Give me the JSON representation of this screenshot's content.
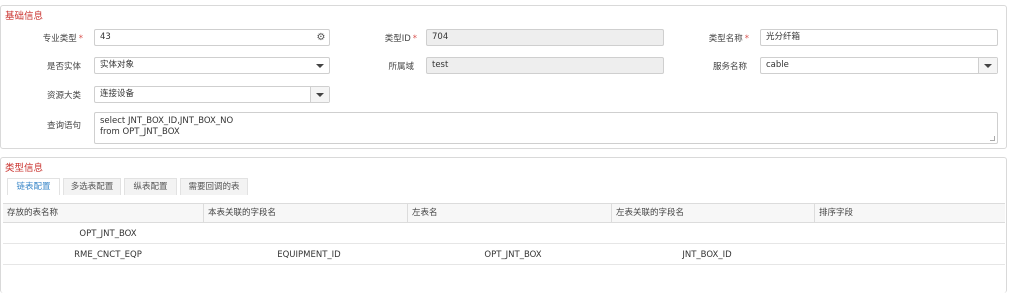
{
  "basic": {
    "title": "基础信息",
    "specialty_label": "专业类型",
    "specialty_value": "43",
    "type_id_label": "类型ID",
    "type_id_value": "704",
    "type_name_label": "类型名称",
    "type_name_value": "光分纤箱",
    "is_entity_label": "是否实体",
    "is_entity_value": "实体对象",
    "domain_label": "所属域",
    "domain_value": "test",
    "service_label": "服务名称",
    "service_value": "cable",
    "resource_label": "资源大类",
    "resource_value": "连接设备",
    "query_label": "查询语句",
    "query_line1": "select JNT_BOX_ID,JNT_BOX_NO",
    "query_line2": "from OPT_JNT_BOX"
  },
  "typeinfo": {
    "title": "类型信息",
    "tabs": [
      "链表配置",
      "多选表配置",
      "纵表配置",
      "需要回调的表"
    ],
    "active_tab": 0,
    "columns": [
      "存放的表名称",
      "本表关联的字段名",
      "左表名",
      "左表关联的字段名",
      "排序字段"
    ],
    "rows": [
      [
        "OPT_JNT_BOX",
        "",
        "",
        "",
        ""
      ],
      [
        "RME_CNCT_EQP",
        "EQUIPMENT_ID",
        "OPT_JNT_BOX",
        "JNT_BOX_ID",
        ""
      ]
    ]
  },
  "icons": {
    "gear": "gear-icon",
    "dropdown": "chevron-down-icon"
  }
}
